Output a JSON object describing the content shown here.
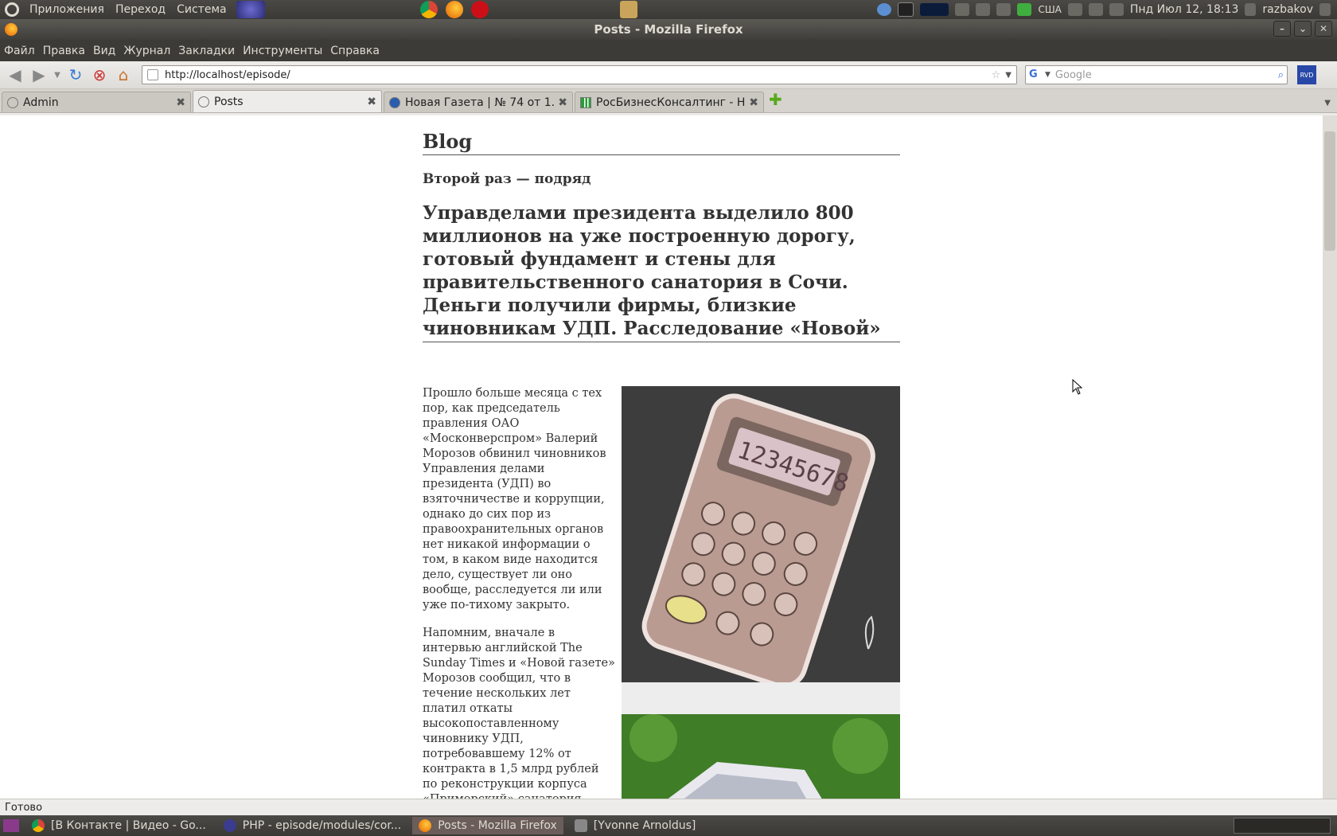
{
  "top_panel": {
    "menus": [
      "Приложения",
      "Переход",
      "Система"
    ],
    "keyboard_layout": "США",
    "datetime": "Пнд Июл 12, 18:13",
    "username": "razbakov"
  },
  "window": {
    "title": "Posts - Mozilla Firefox"
  },
  "menubar": [
    "Файл",
    "Правка",
    "Вид",
    "Журнал",
    "Закладки",
    "Инструменты",
    "Справка"
  ],
  "navbar": {
    "url": "http://localhost/episode/",
    "search_placeholder": "Google"
  },
  "tabs": [
    {
      "label": "Admin",
      "active": false
    },
    {
      "label": "Posts",
      "active": true
    },
    {
      "label": "Новая Газета | № 74 от 1...",
      "active": false
    },
    {
      "label": "РосБизнесКонсалтинг - Н...",
      "active": false
    }
  ],
  "page": {
    "blog_title": "Blog",
    "subtitle": "Второй раз — подряд",
    "headline": "Управделами президента выделило 800 миллионов на уже построенную дорогу, готовый фундамент и стены для правительственного санатория в Сочи. Деньги получили фирмы, близкие чиновникам УДП. Расследование «Новой»",
    "paragraph1": "Прошло больше месяца с тех пор, как председатель правления ОАО «Москонверспром» Валерий Морозов обвинил чиновников Управления делами президента (УДП) во взяточничестве и коррупции, однако до сих пор из правоохранительных органов нет никакой информации о том, в каком виде находится дело, существует ли оно вообще, расследуется ли или уже по-тихому закрыто.",
    "paragraph2": "Напомним, вначале в интервью английской The Sunday Times и «Новой газете» Морозов сообщил, что в течение нескольких лет платил откаты высокопоставленному чиновнику УДП, потребовавшему 12% от контракта в 1,5 млрд рублей по реконструкции корпуса «Приморский» санатория «Сочи» (в нем во время"
  },
  "statusbar": {
    "text": "Готово"
  },
  "taskbar": [
    {
      "label": "[В Контакте | Видео - Go...",
      "active": false
    },
    {
      "label": "PHP - episode/modules/cor...",
      "active": false
    },
    {
      "label": "Posts - Mozilla Firefox",
      "active": true
    },
    {
      "label": "[Yvonne Arnoldus]",
      "active": false
    }
  ]
}
